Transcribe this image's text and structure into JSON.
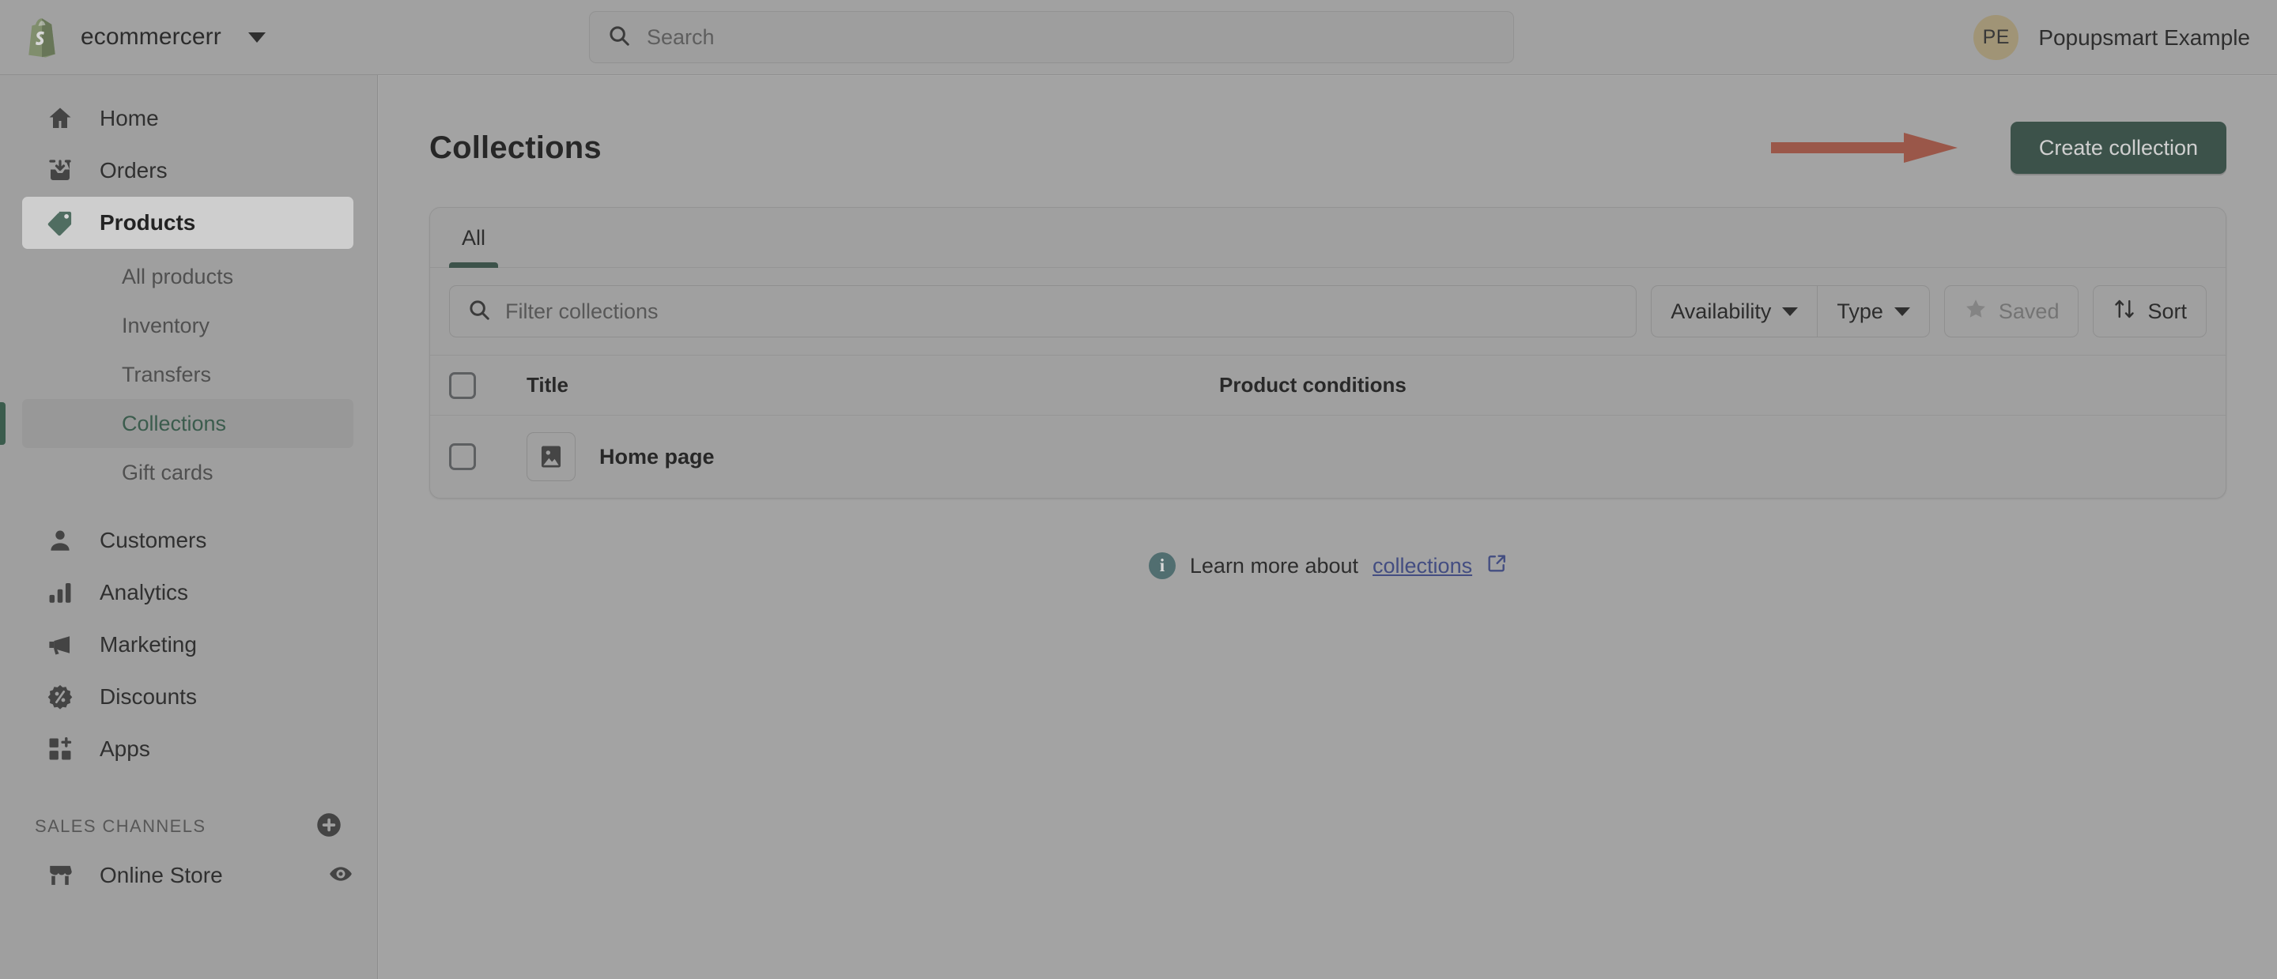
{
  "topbar": {
    "store_name": "ecommercerr",
    "store_switch_icon": "chevron-down-icon",
    "logo_icon": "shopify-bag-icon",
    "search": {
      "placeholder": "Search",
      "value": "",
      "icon": "search-icon"
    },
    "user": {
      "initials": "PE",
      "name": "Popupsmart Example"
    }
  },
  "sidebar": {
    "items": [
      {
        "label": "Home",
        "icon": "home-icon",
        "active": false
      },
      {
        "label": "Orders",
        "icon": "orders-inbox-icon",
        "active": false
      },
      {
        "label": "Products",
        "icon": "product-tag-icon",
        "active": true
      }
    ],
    "subitems": [
      {
        "label": "All products",
        "active": false
      },
      {
        "label": "Inventory",
        "active": false
      },
      {
        "label": "Transfers",
        "active": false
      },
      {
        "label": "Collections",
        "active": true
      },
      {
        "label": "Gift cards",
        "active": false
      }
    ],
    "items2": [
      {
        "label": "Customers",
        "icon": "person-icon"
      },
      {
        "label": "Analytics",
        "icon": "bar-chart-icon"
      },
      {
        "label": "Marketing",
        "icon": "megaphone-icon"
      },
      {
        "label": "Discounts",
        "icon": "discount-badge-icon"
      },
      {
        "label": "Apps",
        "icon": "apps-grid-plus-icon"
      }
    ],
    "sales_channels": {
      "title": "SALES CHANNELS",
      "add_icon": "plus-circle-icon",
      "items": [
        {
          "label": "Online Store",
          "icon": "storefront-icon",
          "action_icon": "eye-icon"
        }
      ]
    }
  },
  "main": {
    "page_title": "Collections",
    "create_button": "Create collection",
    "annotation": {
      "type": "arrow",
      "color": "#f0431f",
      "points_to": "create-collection-button"
    },
    "tabs": [
      {
        "label": "All",
        "active": true
      }
    ],
    "filters": {
      "search": {
        "placeholder": "Filter collections",
        "value": "",
        "icon": "search-icon"
      },
      "buttons": [
        {
          "label": "Availability",
          "icon": "chevron-down-icon",
          "disabled": false
        },
        {
          "label": "Type",
          "icon": "chevron-down-icon",
          "disabled": false
        },
        {
          "label": "Saved",
          "icon": "star-icon",
          "disabled": true
        },
        {
          "label": "Sort",
          "icon": "sort-arrows-icon",
          "disabled": false
        }
      ]
    },
    "table": {
      "columns": [
        "Title",
        "Product conditions"
      ],
      "rows": [
        {
          "title": "Home page",
          "product_conditions": "",
          "thumb_icon": "image-placeholder-icon",
          "selected": false
        }
      ]
    },
    "footnote": {
      "icon": "info-icon",
      "text": "Learn more about",
      "link": "collections",
      "link_icon": "external-link-icon"
    }
  },
  "colors": {
    "brand_green": "#1c5440",
    "accent_green": "#10643f",
    "annotation_red": "#f0431f",
    "avatar_gold": "#c3a457",
    "link_blue": "#2c44c9",
    "info_teal": "#2f7a80"
  }
}
